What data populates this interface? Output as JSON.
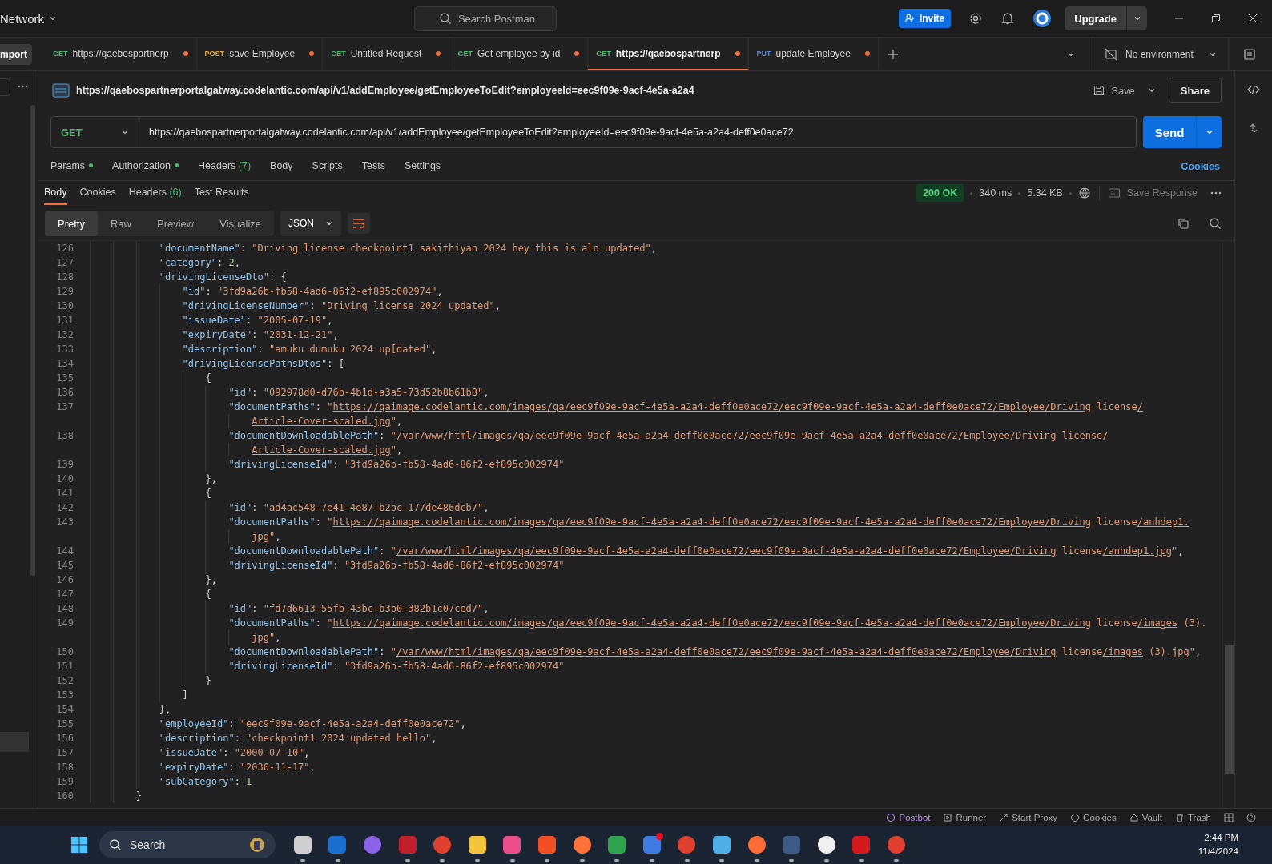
{
  "top_bar": {
    "workspace": "Network",
    "search_placeholder": "Search Postman",
    "invite": "Invite",
    "upgrade": "Upgrade"
  },
  "import_button": "mport",
  "tabs": [
    {
      "method": "GET",
      "title": "https://qaebospartnerp",
      "unsaved": true,
      "selected": false
    },
    {
      "method": "POST",
      "title": "save Employee",
      "unsaved": true,
      "selected": false
    },
    {
      "method": "GET",
      "title": "Untitled Request",
      "unsaved": true,
      "selected": false
    },
    {
      "method": "GET",
      "title": "Get employee by id",
      "unsaved": true,
      "selected": false
    },
    {
      "method": "GET",
      "title": "https://qaebospartnerp",
      "unsaved": true,
      "selected": true
    },
    {
      "method": "PUT",
      "title": "update Employee",
      "unsaved": true,
      "selected": false
    }
  ],
  "environment": "No environment",
  "request": {
    "title": "https://qaebospartnerportalgatway.codelantic.com/api/v1/addEmployee/getEmployeeToEdit?employeeId=eec9f09e-9acf-4e5a-a2a4",
    "save": "Save",
    "share": "Share",
    "method": "GET",
    "url": "https://qaebospartnerportalgatway.codelantic.com/api/v1/addEmployee/getEmployeeToEdit?employeeId=eec9f09e-9acf-4e5a-a2a4-deff0e0ace72",
    "send": "Send"
  },
  "request_tabs": [
    {
      "label": "Params",
      "dot": true,
      "selected": false
    },
    {
      "label": "Authorization",
      "dot": true,
      "selected": false
    },
    {
      "label": "Headers",
      "count": "(7)",
      "dot": false,
      "selected": false
    },
    {
      "label": "Body",
      "dot": false,
      "selected": false
    },
    {
      "label": "Scripts",
      "dot": false,
      "selected": false
    },
    {
      "label": "Tests",
      "dot": false,
      "selected": false
    },
    {
      "label": "Settings",
      "dot": false,
      "selected": false
    }
  ],
  "cookies_link": "Cookies",
  "response_tabs": [
    {
      "label": "Body",
      "selected": true
    },
    {
      "label": "Cookies",
      "selected": false
    },
    {
      "label": "Headers",
      "count": "(6)",
      "selected": false
    },
    {
      "label": "Test Results",
      "selected": false
    }
  ],
  "response_meta": {
    "status": "200 OK",
    "time": "340 ms",
    "size": "5.34 KB",
    "save_response": "Save Response"
  },
  "view_modes": [
    {
      "label": "Pretty",
      "selected": true
    },
    {
      "label": "Raw",
      "selected": false
    },
    {
      "label": "Preview",
      "selected": false
    },
    {
      "label": "Visualize",
      "selected": false
    }
  ],
  "format": "JSON",
  "code_lines": [
    {
      "number": "126",
      "segments": [
        {
          "kind": "k",
          "text": "            \"documentName\""
        },
        {
          "kind": "p",
          "text": ": "
        },
        {
          "kind": "s",
          "text": "\"Driving license checkpoint1 sakithiyan 2024 hey this is alo updated\""
        },
        {
          "kind": "p",
          "text": ","
        }
      ]
    },
    {
      "number": "127",
      "segments": [
        {
          "kind": "k",
          "text": "            \"category\""
        },
        {
          "kind": "p",
          "text": ": "
        },
        {
          "kind": "n",
          "text": "2"
        },
        {
          "kind": "p",
          "text": ","
        }
      ]
    },
    {
      "number": "128",
      "segments": [
        {
          "kind": "k",
          "text": "            \"drivingLicenseDto\""
        },
        {
          "kind": "p",
          "text": ": {"
        }
      ]
    },
    {
      "number": "129",
      "segments": [
        {
          "kind": "k",
          "text": "                \"id\""
        },
        {
          "kind": "p",
          "text": ": "
        },
        {
          "kind": "s",
          "text": "\"3fd9a26b-fb58-4ad6-86f2-ef895c002974\""
        },
        {
          "kind": "p",
          "text": ","
        }
      ]
    },
    {
      "number": "130",
      "segments": [
        {
          "kind": "k",
          "text": "                \"drivingLicenseNumber\""
        },
        {
          "kind": "p",
          "text": ": "
        },
        {
          "kind": "s",
          "text": "\"Driving license 2024 updated\""
        },
        {
          "kind": "p",
          "text": ","
        }
      ]
    },
    {
      "number": "131",
      "segments": [
        {
          "kind": "k",
          "text": "                \"issueDate\""
        },
        {
          "kind": "p",
          "text": ": "
        },
        {
          "kind": "s",
          "text": "\"2005-07-19\""
        },
        {
          "kind": "p",
          "text": ","
        }
      ]
    },
    {
      "number": "132",
      "segments": [
        {
          "kind": "k",
          "text": "                \"expiryDate\""
        },
        {
          "kind": "p",
          "text": ": "
        },
        {
          "kind": "s",
          "text": "\"2031-12-21\""
        },
        {
          "kind": "p",
          "text": ","
        }
      ]
    },
    {
      "number": "133",
      "segments": [
        {
          "kind": "k",
          "text": "                \"description\""
        },
        {
          "kind": "p",
          "text": ": "
        },
        {
          "kind": "s",
          "text": "\"amuku dumuku 2024 up[dated\""
        },
        {
          "kind": "p",
          "text": ","
        }
      ]
    },
    {
      "number": "134",
      "segments": [
        {
          "kind": "k",
          "text": "                \"drivingLicensePathsDtos\""
        },
        {
          "kind": "p",
          "text": ": ["
        }
      ]
    },
    {
      "number": "135",
      "segments": [
        {
          "kind": "p",
          "text": "                    {"
        }
      ]
    },
    {
      "number": "136",
      "segments": [
        {
          "kind": "k",
          "text": "                        \"id\""
        },
        {
          "kind": "p",
          "text": ": "
        },
        {
          "kind": "s",
          "text": "\"092978d0-d76b-4b1d-a3a5-73d52b8b61b8\""
        },
        {
          "kind": "p",
          "text": ","
        }
      ]
    },
    {
      "number": "137",
      "segments": [
        {
          "kind": "k",
          "text": "                        \"documentPaths\""
        },
        {
          "kind": "p",
          "text": ": "
        },
        {
          "kind": "s",
          "text": "\""
        },
        {
          "kind": "u",
          "text": "https://qaimage.codelantic.com/images/qa/eec9f09e-9acf-4e5a-a2a4-deff0e0ace72/eec9f09e-9acf-4e5a-a2a4-deff0e0ace72/Employee/Driving"
        },
        {
          "kind": "s",
          "text": " license"
        },
        {
          "kind": "u",
          "text": "/"
        }
      ]
    },
    {
      "segments": [
        {
          "kind": "u",
          "text": "                            Article-Cover-scaled.jpg"
        },
        {
          "kind": "s",
          "text": "\""
        },
        {
          "kind": "p",
          "text": ","
        }
      ]
    },
    {
      "number": "138",
      "segments": [
        {
          "kind": "k",
          "text": "                        \"documentDownloadablePath\""
        },
        {
          "kind": "p",
          "text": ": "
        },
        {
          "kind": "s",
          "text": "\""
        },
        {
          "kind": "u",
          "text": "/var/www/html/images/qa/eec9f09e-9acf-4e5a-a2a4-deff0e0ace72/eec9f09e-9acf-4e5a-a2a4-deff0e0ace72/Employee/Driving"
        },
        {
          "kind": "s",
          "text": " license"
        },
        {
          "kind": "u",
          "text": "/"
        }
      ]
    },
    {
      "segments": [
        {
          "kind": "u",
          "text": "                            Article-Cover-scaled.jpg"
        },
        {
          "kind": "s",
          "text": "\""
        },
        {
          "kind": "p",
          "text": ","
        }
      ]
    },
    {
      "number": "139",
      "segments": [
        {
          "kind": "k",
          "text": "                        \"drivingLicenseId\""
        },
        {
          "kind": "p",
          "text": ": "
        },
        {
          "kind": "s",
          "text": "\"3fd9a26b-fb58-4ad6-86f2-ef895c002974\""
        }
      ]
    },
    {
      "number": "140",
      "segments": [
        {
          "kind": "p",
          "text": "                    },"
        }
      ]
    },
    {
      "number": "141",
      "segments": [
        {
          "kind": "p",
          "text": "                    {"
        }
      ]
    },
    {
      "number": "142",
      "segments": [
        {
          "kind": "k",
          "text": "                        \"id\""
        },
        {
          "kind": "p",
          "text": ": "
        },
        {
          "kind": "s",
          "text": "\"ad4ac548-7e41-4e87-b2bc-177de486dcb7\""
        },
        {
          "kind": "p",
          "text": ","
        }
      ]
    },
    {
      "number": "143",
      "segments": [
        {
          "kind": "k",
          "text": "                        \"documentPaths\""
        },
        {
          "kind": "p",
          "text": ": "
        },
        {
          "kind": "s",
          "text": "\""
        },
        {
          "kind": "u",
          "text": "https://qaimage.codelantic.com/images/qa/eec9f09e-9acf-4e5a-a2a4-deff0e0ace72/eec9f09e-9acf-4e5a-a2a4-deff0e0ace72/Employee/Driving"
        },
        {
          "kind": "s",
          "text": " license"
        },
        {
          "kind": "u",
          "text": "/anhdep1."
        }
      ]
    },
    {
      "segments": [
        {
          "kind": "u",
          "text": "                            jpg"
        },
        {
          "kind": "s",
          "text": "\""
        },
        {
          "kind": "p",
          "text": ","
        }
      ]
    },
    {
      "number": "144",
      "segments": [
        {
          "kind": "k",
          "text": "                        \"documentDownloadablePath\""
        },
        {
          "kind": "p",
          "text": ": "
        },
        {
          "kind": "s",
          "text": "\""
        },
        {
          "kind": "u",
          "text": "/var/www/html/images/qa/eec9f09e-9acf-4e5a-a2a4-deff0e0ace72/eec9f09e-9acf-4e5a-a2a4-deff0e0ace72/Employee/Driving"
        },
        {
          "kind": "s",
          "text": " license"
        },
        {
          "kind": "u",
          "text": "/anhdep1.jpg"
        },
        {
          "kind": "s",
          "text": "\""
        },
        {
          "kind": "p",
          "text": ","
        }
      ]
    },
    {
      "number": "145",
      "segments": [
        {
          "kind": "k",
          "text": "                        \"drivingLicenseId\""
        },
        {
          "kind": "p",
          "text": ": "
        },
        {
          "kind": "s",
          "text": "\"3fd9a26b-fb58-4ad6-86f2-ef895c002974\""
        }
      ]
    },
    {
      "number": "146",
      "segments": [
        {
          "kind": "p",
          "text": "                    },"
        }
      ]
    },
    {
      "number": "147",
      "segments": [
        {
          "kind": "p",
          "text": "                    {"
        }
      ]
    },
    {
      "number": "148",
      "segments": [
        {
          "kind": "k",
          "text": "                        \"id\""
        },
        {
          "kind": "p",
          "text": ": "
        },
        {
          "kind": "s",
          "text": "\"fd7d6613-55fb-43bc-b3b0-382b1c07ced7\""
        },
        {
          "kind": "p",
          "text": ","
        }
      ]
    },
    {
      "number": "149",
      "segments": [
        {
          "kind": "k",
          "text": "                        \"documentPaths\""
        },
        {
          "kind": "p",
          "text": ": "
        },
        {
          "kind": "s",
          "text": "\""
        },
        {
          "kind": "u",
          "text": "https://qaimage.codelantic.com/images/qa/eec9f09e-9acf-4e5a-a2a4-deff0e0ace72/eec9f09e-9acf-4e5a-a2a4-deff0e0ace72/Employee/Driving"
        },
        {
          "kind": "s",
          "text": " license"
        },
        {
          "kind": "u",
          "text": "/images"
        },
        {
          "kind": "s",
          "text": " (3)."
        }
      ]
    },
    {
      "segments": [
        {
          "kind": "s",
          "text": "                            jpg\""
        },
        {
          "kind": "p",
          "text": ","
        }
      ]
    },
    {
      "number": "150",
      "segments": [
        {
          "kind": "k",
          "text": "                        \"documentDownloadablePath\""
        },
        {
          "kind": "p",
          "text": ": "
        },
        {
          "kind": "s",
          "text": "\""
        },
        {
          "kind": "u",
          "text": "/var/www/html/images/qa/eec9f09e-9acf-4e5a-a2a4-deff0e0ace72/eec9f09e-9acf-4e5a-a2a4-deff0e0ace72/Employee/Driving"
        },
        {
          "kind": "s",
          "text": " license"
        },
        {
          "kind": "u",
          "text": "/images"
        },
        {
          "kind": "s",
          "text": " (3).jpg\""
        },
        {
          "kind": "p",
          "text": ","
        }
      ]
    },
    {
      "number": "151",
      "segments": [
        {
          "kind": "k",
          "text": "                        \"drivingLicenseId\""
        },
        {
          "kind": "p",
          "text": ": "
        },
        {
          "kind": "s",
          "text": "\"3fd9a26b-fb58-4ad6-86f2-ef895c002974\""
        }
      ]
    },
    {
      "number": "152",
      "segments": [
        {
          "kind": "p",
          "text": "                    }"
        }
      ]
    },
    {
      "number": "153",
      "segments": [
        {
          "kind": "p",
          "text": "                ]"
        }
      ]
    },
    {
      "number": "154",
      "segments": [
        {
          "kind": "p",
          "text": "            },"
        }
      ]
    },
    {
      "number": "155",
      "segments": [
        {
          "kind": "k",
          "text": "            \"employeeId\""
        },
        {
          "kind": "p",
          "text": ": "
        },
        {
          "kind": "s",
          "text": "\"eec9f09e-9acf-4e5a-a2a4-deff0e0ace72\""
        },
        {
          "kind": "p",
          "text": ","
        }
      ]
    },
    {
      "number": "156",
      "segments": [
        {
          "kind": "k",
          "text": "            \"description\""
        },
        {
          "kind": "p",
          "text": ": "
        },
        {
          "kind": "s",
          "text": "\"checkpoint1 2024 updated hello\""
        },
        {
          "kind": "p",
          "text": ","
        }
      ]
    },
    {
      "number": "157",
      "segments": [
        {
          "kind": "k",
          "text": "            \"issueDate\""
        },
        {
          "kind": "p",
          "text": ": "
        },
        {
          "kind": "s",
          "text": "\"2000-07-10\""
        },
        {
          "kind": "p",
          "text": ","
        }
      ]
    },
    {
      "number": "158",
      "segments": [
        {
          "kind": "k",
          "text": "            \"expiryDate\""
        },
        {
          "kind": "p",
          "text": ": "
        },
        {
          "kind": "s",
          "text": "\"2030-11-17\""
        },
        {
          "kind": "p",
          "text": ","
        }
      ]
    },
    {
      "number": "159",
      "segments": [
        {
          "kind": "k",
          "text": "            \"subCategory\""
        },
        {
          "kind": "p",
          "text": ": "
        },
        {
          "kind": "n",
          "text": "1"
        }
      ]
    },
    {
      "number": "160",
      "segments": [
        {
          "kind": "p",
          "text": "        }"
        }
      ]
    }
  ],
  "status_bar": [
    {
      "kind": "postbot",
      "label": "Postbot"
    },
    {
      "kind": "runner",
      "label": "Runner"
    },
    {
      "kind": "proxy",
      "label": "Start Proxy"
    },
    {
      "kind": "cookies",
      "label": "Cookies"
    },
    {
      "kind": "vault",
      "label": "Vault"
    },
    {
      "kind": "trash",
      "label": "Trash"
    }
  ],
  "taskbar": {
    "search": "Search",
    "time": "2:44 PM",
    "date": "11/4/2024",
    "apps": [
      {
        "kind": "square",
        "color": "#cfcfcf",
        "open": true,
        "badge": false
      },
      {
        "kind": "square",
        "color": "#1b6fd1",
        "open": true,
        "badge": false
      },
      {
        "kind": "circle",
        "color": "#8a63e6",
        "open": false,
        "badge": false
      },
      {
        "kind": "square",
        "color": "#c0202a",
        "open": true,
        "badge": false
      },
      {
        "kind": "circle",
        "color": "#e0402f",
        "open": true,
        "badge": false
      },
      {
        "kind": "square",
        "color": "#f3c33b",
        "open": true,
        "badge": false
      },
      {
        "kind": "square",
        "color": "#e94d8a",
        "open": true,
        "badge": false
      },
      {
        "kind": "square",
        "color": "#f25022",
        "open": true,
        "badge": false
      },
      {
        "kind": "circle",
        "color": "#ff7139",
        "open": true,
        "badge": false
      },
      {
        "kind": "square",
        "color": "#2ea44f",
        "open": true,
        "badge": false
      },
      {
        "kind": "square",
        "color": "#3d7be0",
        "open": true,
        "badge": true
      },
      {
        "kind": "circle",
        "color": "#e0402f",
        "open": true,
        "badge": false
      },
      {
        "kind": "square",
        "color": "#4fb0e8",
        "open": true,
        "badge": false
      },
      {
        "kind": "circle",
        "color": "#ff6c37",
        "open": true,
        "badge": false
      },
      {
        "kind": "square",
        "color": "#3b5b85",
        "open": true,
        "badge": false
      },
      {
        "kind": "circle",
        "color": "#f0f0f0",
        "open": true,
        "badge": false
      },
      {
        "kind": "square",
        "color": "#d3191c",
        "open": true,
        "badge": false
      },
      {
        "kind": "circle",
        "color": "#e0402f",
        "open": true,
        "badge": false
      }
    ]
  }
}
